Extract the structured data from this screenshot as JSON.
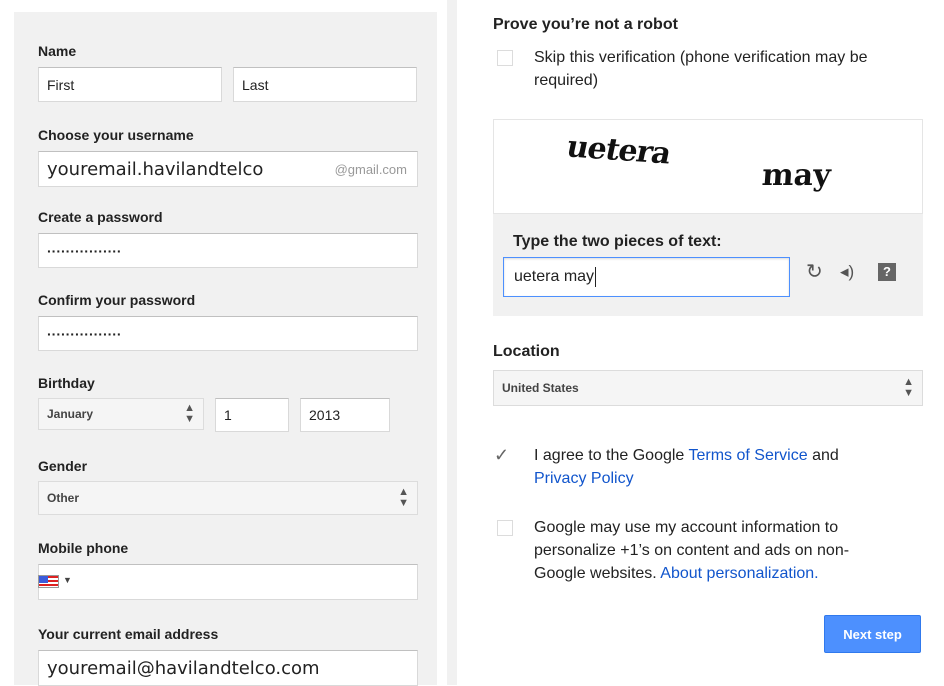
{
  "form": {
    "name_label": "Name",
    "first_placeholder": "First",
    "last_placeholder": "Last",
    "username_label": "Choose your username",
    "username_value": "youremail.havilandtelco",
    "username_suffix": "@gmail.com",
    "password_label": "Create a password",
    "password_mask": "················",
    "confirm_label": "Confirm your password",
    "confirm_mask": "················",
    "birthday_label": "Birthday",
    "birth_month": "January",
    "birth_day": "1",
    "birth_year": "2013",
    "gender_label": "Gender",
    "gender_value": "Other",
    "phone_label": "Mobile phone",
    "current_email_label": "Your current email address",
    "current_email_value": "youremail@havilandtelco.com"
  },
  "robot": {
    "title": "Prove you’re not a robot",
    "skip_text_line1": "Skip this verification (phone verification may be",
    "skip_text_line2": "required)",
    "captcha_word1": "uetera",
    "captcha_word2": "may",
    "type_label": "Type the two pieces of text:",
    "captcha_input_value": "uetera may"
  },
  "location": {
    "label": "Location",
    "value": "United States"
  },
  "terms": {
    "prefix": "I agree to the Google ",
    "tos_link": "Terms of Service",
    "and": " and",
    "privacy_link": "Privacy Policy",
    "checked": true
  },
  "personalize": {
    "line1": "Google may use my account information to",
    "line2": "personalize +1’s on content and ads on non-",
    "line3": "Google websites. ",
    "link": "About personalization."
  },
  "next_button": "Next step",
  "colors": {
    "accent": "#4d90fe",
    "link": "#1155cc",
    "panel": "#f1f1f1"
  }
}
